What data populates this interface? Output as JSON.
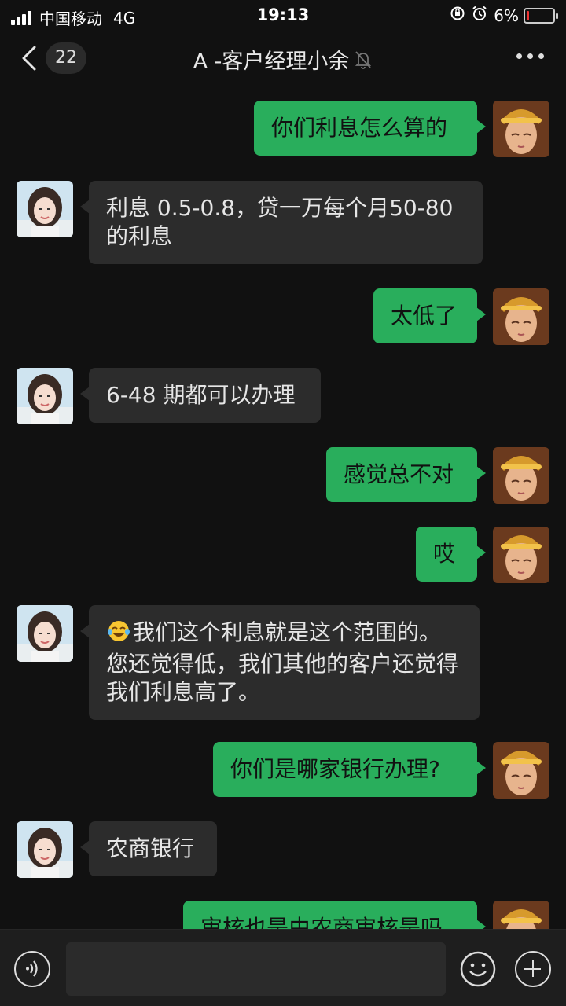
{
  "status_bar": {
    "carrier": "中国移动",
    "network": "4G",
    "time": "19:13",
    "battery": "6%",
    "battery_level": 0.06
  },
  "nav": {
    "unread_count": "22",
    "title": "A -客户经理小余"
  },
  "messages": [
    {
      "from": "me",
      "text": "你们利息怎么算的"
    },
    {
      "from": "them",
      "text": "利息 0.5-0.8，贷一万每个月50-80的利息"
    },
    {
      "from": "me",
      "text": "太低了"
    },
    {
      "from": "them",
      "text": "6-48 期都可以办理"
    },
    {
      "from": "me",
      "text": "感觉总不对"
    },
    {
      "from": "me",
      "text": "哎"
    },
    {
      "from": "them",
      "text": "我们这个利息就是这个范围的。您还觉得低，我们其他的客户还觉得我们利息高了。",
      "emoji": "tears-of-joy-emoji"
    },
    {
      "from": "me",
      "text": "你们是哪家银行办理?"
    },
    {
      "from": "them",
      "text": "农商银行"
    },
    {
      "from": "me",
      "text": "审核也是由农商审核是吗"
    }
  ],
  "colors": {
    "background": "#111111",
    "my_bubble": "#29ae5c",
    "their_bubble": "#2c2c2c",
    "input_bar": "#1e1e1e"
  },
  "icons": {
    "back": "chevron-left-icon",
    "mute": "bell-mute-icon",
    "more": "more-dots-icon",
    "voice": "voice-icon",
    "emoji": "emoji-face-icon",
    "plus": "plus-icon"
  }
}
